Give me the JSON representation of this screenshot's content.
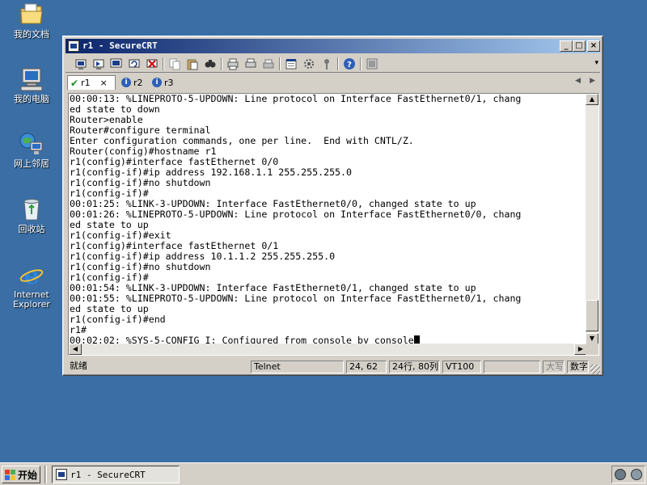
{
  "desktop": {
    "icons": [
      {
        "label": "我的文档",
        "icon": "my-documents-icon"
      },
      {
        "label": "我的电脑",
        "icon": "my-computer-icon"
      },
      {
        "label": "网上邻居",
        "icon": "network-places-icon"
      },
      {
        "label": "回收站",
        "icon": "recycle-bin-icon"
      },
      {
        "label": "Internet Explorer",
        "icon": "internet-explorer-icon"
      }
    ]
  },
  "window": {
    "title": "r1 - SecureCRT",
    "controls": {
      "minimize": "_",
      "maximize": "□",
      "close": "×"
    }
  },
  "tabs": [
    {
      "label": "r1",
      "status": "connected",
      "close": "×"
    },
    {
      "label": "r2",
      "status": "info"
    },
    {
      "label": "r3",
      "status": "info"
    }
  ],
  "terminal": {
    "lines": [
      "00:00:13: %LINEPROTO-5-UPDOWN: Line protocol on Interface FastEthernet0/1, chang",
      "ed state to down",
      "Router>enable",
      "Router#configure terminal",
      "Enter configuration commands, one per line.  End with CNTL/Z.",
      "Router(config)#hostname r1",
      "r1(config)#interface fastEthernet 0/0",
      "r1(config-if)#ip address 192.168.1.1 255.255.255.0",
      "r1(config-if)#no shutdown",
      "r1(config-if)#",
      "00:01:25: %LINK-3-UPDOWN: Interface FastEthernet0/0, changed state to up",
      "00:01:26: %LINEPROTO-5-UPDOWN: Line protocol on Interface FastEthernet0/0, chang",
      "ed state to up",
      "r1(config-if)#exit",
      "r1(config)#interface fastEthernet 0/1",
      "r1(config-if)#ip address 10.1.1.2 255.255.255.0",
      "r1(config-if)#no shutdown",
      "r1(config-if)#",
      "00:01:54: %LINK-3-UPDOWN: Interface FastEthernet0/1, changed state to up",
      "00:01:55: %LINEPROTO-5-UPDOWN: Line protocol on Interface FastEthernet0/1, chang",
      "ed state to up",
      "r1(config-if)#end",
      "r1#",
      "00:02:02: %SYS-5-CONFIG_I: Configured from console by console"
    ]
  },
  "statusbar": {
    "ready": "就绪",
    "protocol": "Telnet",
    "cursor_pos": "24, 62",
    "size": "24行, 80列",
    "emulation": "VT100",
    "caps": "大写",
    "num": "数字"
  },
  "taskbar": {
    "start_label": "开始",
    "task_label": "r1 - SecureCRT"
  },
  "colors": {
    "desktop": "#3a6ea5",
    "titlebar_start": "#0a246a",
    "titlebar_end": "#a6caf0"
  }
}
